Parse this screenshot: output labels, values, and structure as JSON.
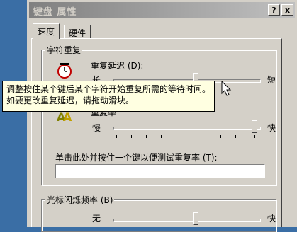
{
  "window": {
    "title": "键盘 属性",
    "help_btn": "?",
    "close_btn": "x"
  },
  "tabs": [
    {
      "label": "速度"
    },
    {
      "label": "硬件"
    }
  ],
  "repeat_group": {
    "label": "字符重复",
    "delay_label": "重复延迟 (D):",
    "delay_left": "长",
    "delay_right": "短",
    "rate_label": "重复率",
    "rate_left": "慢",
    "rate_right": "快",
    "test_label": "单击此处并按住一个键以便测试重复率 (T):",
    "test_value": ""
  },
  "cursor_group": {
    "label": "光标闪烁频率 (B)",
    "left": "无",
    "right": "快"
  },
  "tooltip": {
    "text": "调整按住某个键后某个字符开始重复所需的等待时间。如要更改重复延迟，请拖动滑块。"
  }
}
